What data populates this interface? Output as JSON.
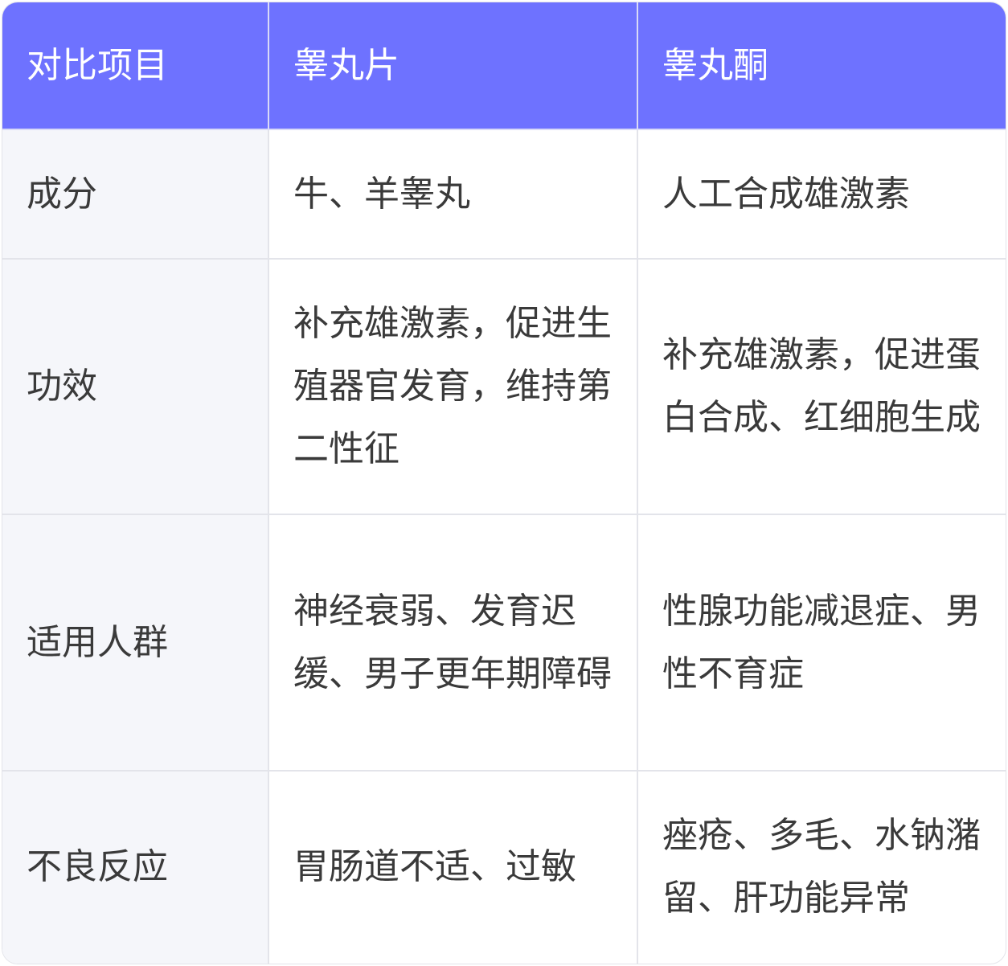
{
  "header": [
    "对比项目",
    "睾丸片",
    "睾丸酮"
  ],
  "rows": [
    [
      "成分",
      "牛、羊睾丸",
      "人工合成雄激素"
    ],
    [
      "功效",
      "补充雄激素，促进生殖器官发育，维持第二性征",
      "补充雄激素，促进蛋白合成、红细胞生成"
    ],
    [
      "适用人群",
      "神经衰弱、发育迟缓、男子更年期障碍",
      "性腺功能减退症、男性不育症"
    ],
    [
      "不良反应",
      "胃肠道不适、过敏",
      "痤疮、多毛、水钠潴留、肝功能异常"
    ]
  ],
  "colors": {
    "header_bg": "#6e72ff",
    "header_text": "#ffffff",
    "label_bg": "#f5f6fa",
    "border": "#e3e4ea",
    "text": "#3a3a3a"
  }
}
